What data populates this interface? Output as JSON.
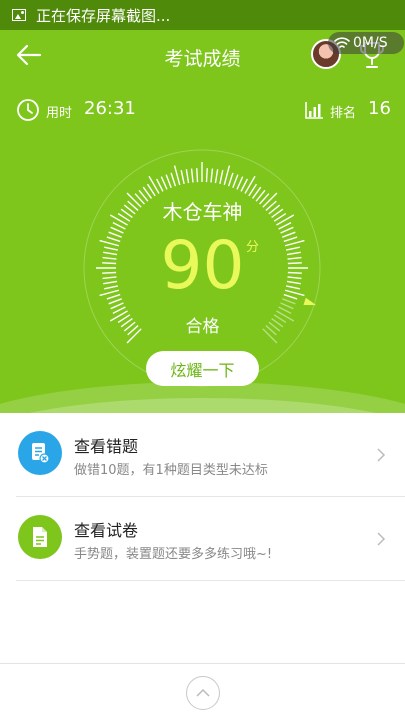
{
  "status_bar": {
    "text": "正在保存屏幕截图..."
  },
  "network": {
    "speed": "0M/S"
  },
  "header": {
    "title": "考试成绩"
  },
  "stats": {
    "time_label": "用时",
    "time_value": "26:31",
    "rank_label": "排名",
    "rank_value": "16"
  },
  "result": {
    "nickname": "木仓车神",
    "score": "90",
    "score_unit": "分",
    "verdict": "合格",
    "score_max": 100
  },
  "share_button": {
    "label": "炫耀一下"
  },
  "items": [
    {
      "title": "查看错题",
      "subtitle": "做错10题，有1种题目类型未达标",
      "icon": "wrong-questions-icon",
      "color": "#2aa6e8"
    },
    {
      "title": "查看试卷",
      "subtitle": "手势题，装置题还要多多练习哦~!",
      "icon": "exam-paper-icon",
      "color": "#7ec61c"
    }
  ],
  "colors": {
    "hero_bg": "#7ec61c",
    "score": "#e9f85a",
    "status_bar": "#4f8a0a"
  }
}
